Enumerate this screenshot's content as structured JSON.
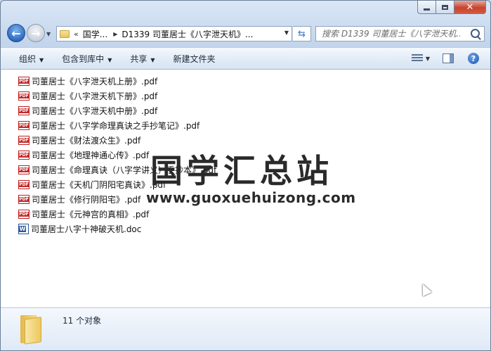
{
  "window": {
    "close_glyph": "✕",
    "colors": {
      "close": "#c7432f",
      "chrome": "#c3d5ec"
    }
  },
  "nav": {
    "back_glyph": "←",
    "forward_glyph": "→",
    "breadcrumb_prefix": "«",
    "crumbs": [
      "国学...",
      "D1339 司董居士《八字泄天机》..."
    ],
    "refresh_glyph": "⇆",
    "search_placeholder": "搜索 D1339 司董居士《八字泄天机..."
  },
  "toolbar": {
    "organize": "组织",
    "include_in_library": "包含到库中",
    "share": "共享",
    "new_folder": "新建文件夹",
    "help_glyph": "?"
  },
  "files": [
    {
      "name": "司董居士《八字泄天机上册》.pdf",
      "type": "pdf"
    },
    {
      "name": "司董居士《八字泄天机下册》.pdf",
      "type": "pdf"
    },
    {
      "name": "司董居士《八字泄天机中册》.pdf",
      "type": "pdf"
    },
    {
      "name": "司董居士《八字学命理真诀之手抄笔记》.pdf",
      "type": "pdf"
    },
    {
      "name": "司董居士《财法渡众生》.pdf",
      "type": "pdf"
    },
    {
      "name": "司董居士《地理神通心传》.pdf",
      "type": "pdf"
    },
    {
      "name": "司董居士《命理真诀（八字学讲义）手抄本》.pdf",
      "type": "pdf"
    },
    {
      "name": "司董居士《天机门阴阳宅真诀》.pdf",
      "type": "pdf"
    },
    {
      "name": "司董居士《修行阴阳宅》.pdf",
      "type": "pdf"
    },
    {
      "name": "司董居士《元神宫的真相》.pdf",
      "type": "pdf"
    },
    {
      "name": "司董居士八字十神破天机.doc",
      "type": "doc"
    }
  ],
  "watermark": {
    "title": "国学汇总站",
    "url": "www.guoxuehuizong.com"
  },
  "details": {
    "count": "11 个对象"
  }
}
